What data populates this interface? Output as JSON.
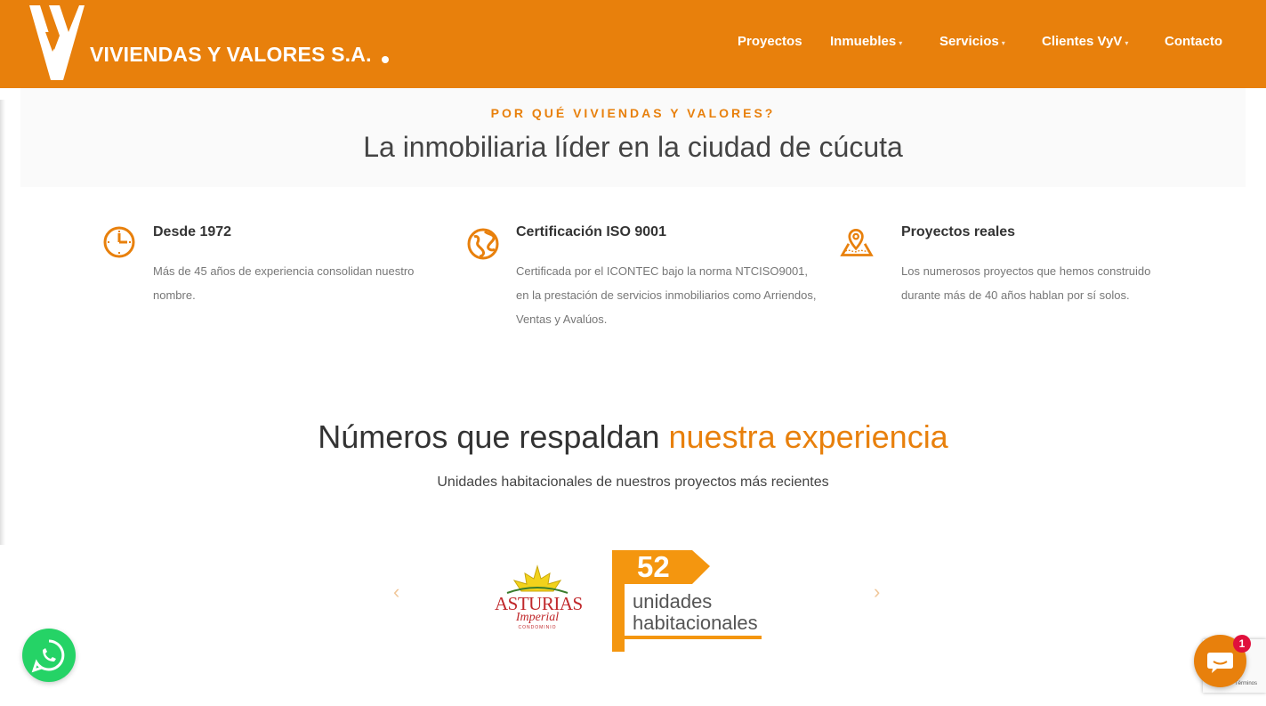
{
  "brand": {
    "name": "VIVIENDAS Y VALORES S.A.",
    "accent_color": "#e8800c",
    "logo_icon": "vyv-logo-icon"
  },
  "nav": {
    "items": [
      {
        "label": "Proyectos",
        "has_dropdown": false
      },
      {
        "label": "Inmuebles",
        "has_dropdown": true
      },
      {
        "label": "Servicios",
        "has_dropdown": true
      },
      {
        "label": "Clientes VyV",
        "has_dropdown": true
      },
      {
        "label": "Contacto",
        "has_dropdown": false
      }
    ]
  },
  "why": {
    "eyebrow": "POR QUÉ VIVIENDAS Y VALORES?",
    "title": "La inmobiliaria líder en la ciudad de cúcuta"
  },
  "features": [
    {
      "icon": "clock-icon",
      "title": "Desde 1972",
      "text": "Más de 45 años de experiencia consolidan nuestro nombre."
    },
    {
      "icon": "globe-icon",
      "title": "Certificación ISO 9001",
      "text": "Certificada por el ICONTEC bajo la norma NTCISO9001, en la prestación de servicios inmobiliarios como Arriendos, Ventas y Avalúos."
    },
    {
      "icon": "map-pin-icon",
      "title": "Proyectos reales",
      "text": "Los numerosos proyectos que hemos construido durante más de 40 años hablan por sí solos."
    }
  ],
  "numbers": {
    "title_plain": "Números que respaldan ",
    "title_accent": "nuestra experiencia",
    "subtitle": "Unidades habitacionales de nuestros proyectos más recientes"
  },
  "carousel": {
    "prev_label": "‹",
    "next_label": "›",
    "project_name": "ASTURIAS",
    "project_sub": "Imperial",
    "project_tag": "CONDOMINIO",
    "count": "52",
    "count_line1": "unidades",
    "count_line2": "habitacionales"
  },
  "widgets": {
    "whatsapp_icon": "whatsapp-icon",
    "chat_icon": "chat-icon",
    "chat_badge": "1",
    "recaptcha_terms": "Términos"
  }
}
